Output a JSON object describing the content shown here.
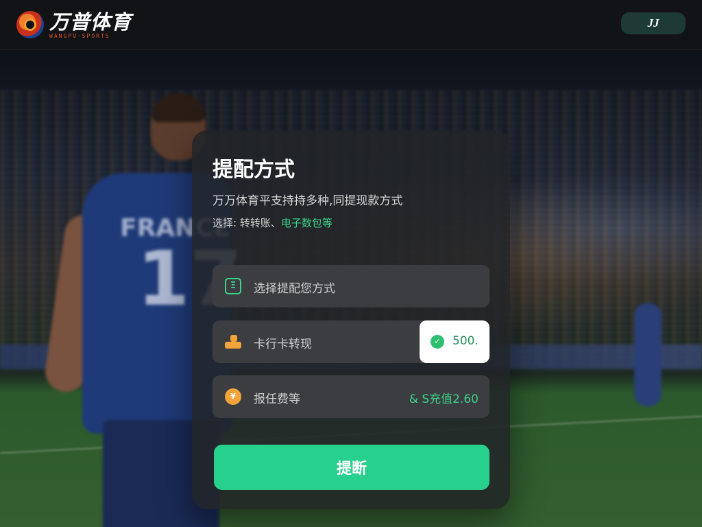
{
  "header": {
    "logo_title": "万普体育",
    "logo_subtitle": "WANGPU·SPORTS",
    "top_button_label": "JJ"
  },
  "background": {
    "jersey_name": "FRANCE",
    "jersey_number": "17"
  },
  "card": {
    "title": "提配方式",
    "description": "万万体育平支持持多种,同提现款方式",
    "subdesc_prefix": "选择: 转转账、",
    "subdesc_highlight": "电子数包等",
    "rows": [
      {
        "icon": "select-icon",
        "label": "选择提配您方式"
      },
      {
        "icon": "bank-card-icon",
        "label": "卡行卡转现",
        "chip_icon": "check-circle-icon",
        "chip_value": "500."
      },
      {
        "icon": "fee-icon",
        "label": "报任费等",
        "value": "& S充值2.60"
      }
    ],
    "submit_label": "提断"
  },
  "colors": {
    "accent": "#27d08c",
    "highlight_text": "#3bd38a",
    "icon_orange": "#f2a33a",
    "card_bg": "#222428"
  }
}
